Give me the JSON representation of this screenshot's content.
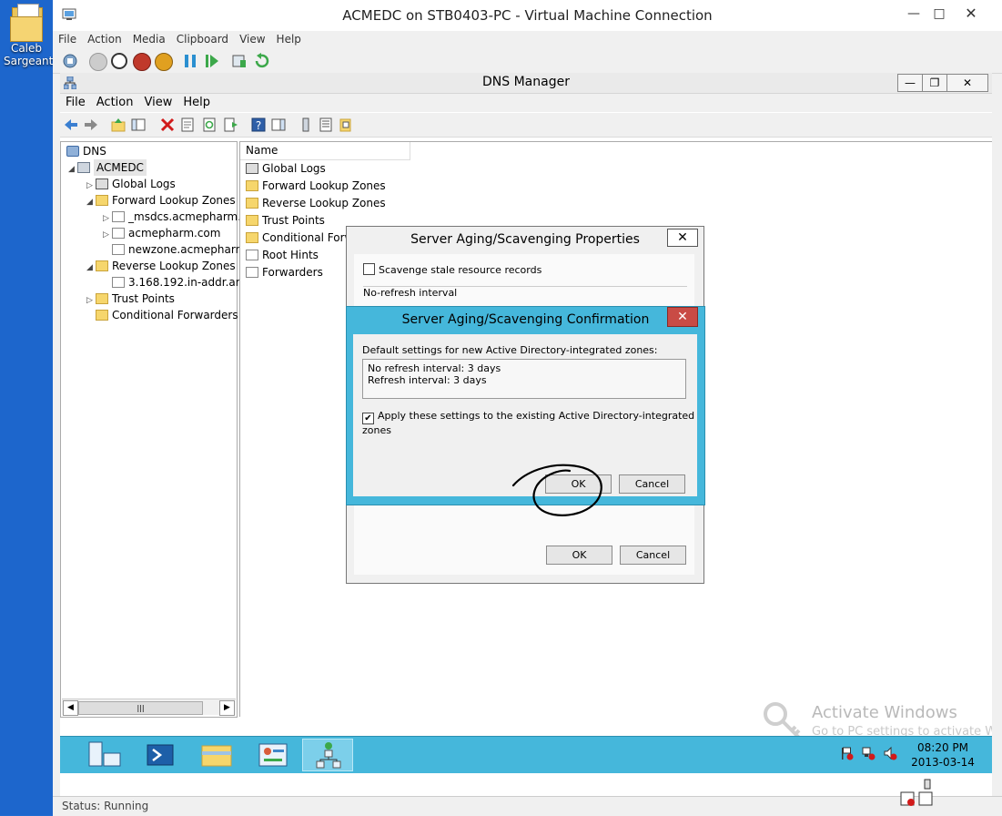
{
  "desktop": {
    "icon_label": "Caleb Sargeant"
  },
  "vm_window": {
    "title": "ACMEDC on STB0403-PC - Virtual Machine Connection",
    "menu": [
      "File",
      "Action",
      "Media",
      "Clipboard",
      "View",
      "Help"
    ],
    "status": "Status: Running",
    "controls": {
      "minimize": "—",
      "maximize": "□",
      "close": "✕"
    }
  },
  "dns_manager": {
    "title": "DNS Manager",
    "menu": [
      "File",
      "Action",
      "View",
      "Help"
    ],
    "controls": {
      "minimize": "—",
      "restore": "❐",
      "close": "✕"
    },
    "tree": {
      "root": "DNS",
      "server": "ACMEDC",
      "global_logs": "Global Logs",
      "forward_zones": "Forward Lookup Zones",
      "fz_items": [
        "_msdcs.acmepharm.c",
        "acmepharm.com",
        "newzone.acmepharm"
      ],
      "reverse_zones": "Reverse Lookup Zones",
      "rz_items": [
        "3.168.192.in-addr.arp"
      ],
      "trust_points": "Trust Points",
      "conditional_forwarders": "Conditional Forwarders"
    },
    "list": {
      "column_name": "Name",
      "items": [
        "Global Logs",
        "Forward Lookup Zones",
        "Reverse Lookup Zones",
        "Trust Points",
        "Conditional Forw",
        "Root Hints",
        "Forwarders"
      ]
    }
  },
  "props_dialog": {
    "title": "Server Aging/Scavenging Properties",
    "close": "✕",
    "scavenge_label": "Scavenge stale resource records",
    "scavenge_checked": false,
    "norefresh_label": "No-refresh interval",
    "ok": "OK",
    "cancel": "Cancel"
  },
  "confirm_dialog": {
    "title": "Server Aging/Scavenging Confirmation",
    "close": "✕",
    "description": "Default settings for new Active Directory-integrated zones:",
    "line1": "No refresh interval: 3 days",
    "line2": "Refresh interval: 3 days",
    "apply_label": "Apply these settings to the existing Active Directory-integrated zones",
    "apply_checked": true,
    "ok": "OK",
    "cancel": "Cancel"
  },
  "taskbar": {
    "time": "08:20 PM",
    "date": "2013-03-14"
  },
  "watermark": {
    "line1": "Activate Windows",
    "line2": "Go to PC settings to activate W"
  },
  "colors": {
    "accent": "#45b7db",
    "close_red": "#c94b45"
  }
}
